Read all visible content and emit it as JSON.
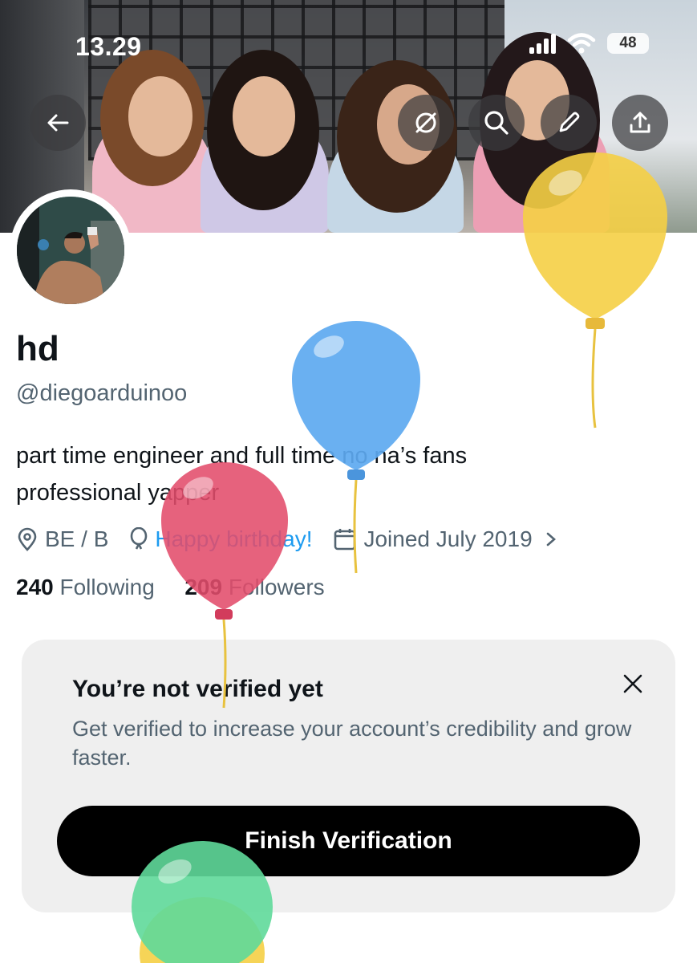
{
  "status_bar": {
    "time": "13.29",
    "battery": "48"
  },
  "header_actions": {
    "back": "back-arrow-icon",
    "grok": "grok-icon",
    "search": "search-icon",
    "edit": "pencil-icon",
    "share": "share-icon"
  },
  "profile": {
    "name": "hd",
    "handle": "@diegoarduinoo",
    "bio_line1": "part time engineer and full time no na’s fans",
    "bio_line2": "professional yapper",
    "location": "BE / B",
    "birthday": "Happy birthday!",
    "joined": "Joined July 2019",
    "following_count": "240",
    "following_label": "Following",
    "followers_count": "209",
    "followers_label": "Followers"
  },
  "verification_card": {
    "title": "You’re not verified yet",
    "body": "Get verified to increase your account’s credibility and grow faster.",
    "cta": "Finish Verification"
  },
  "colors": {
    "link_blue": "#1d9bf0",
    "secondary_text": "#536471",
    "balloon_yellow": "#f5cf45",
    "balloon_blue": "#5da9f0",
    "balloon_red": "#e24c6b",
    "balloon_green": "#5fd99a"
  }
}
